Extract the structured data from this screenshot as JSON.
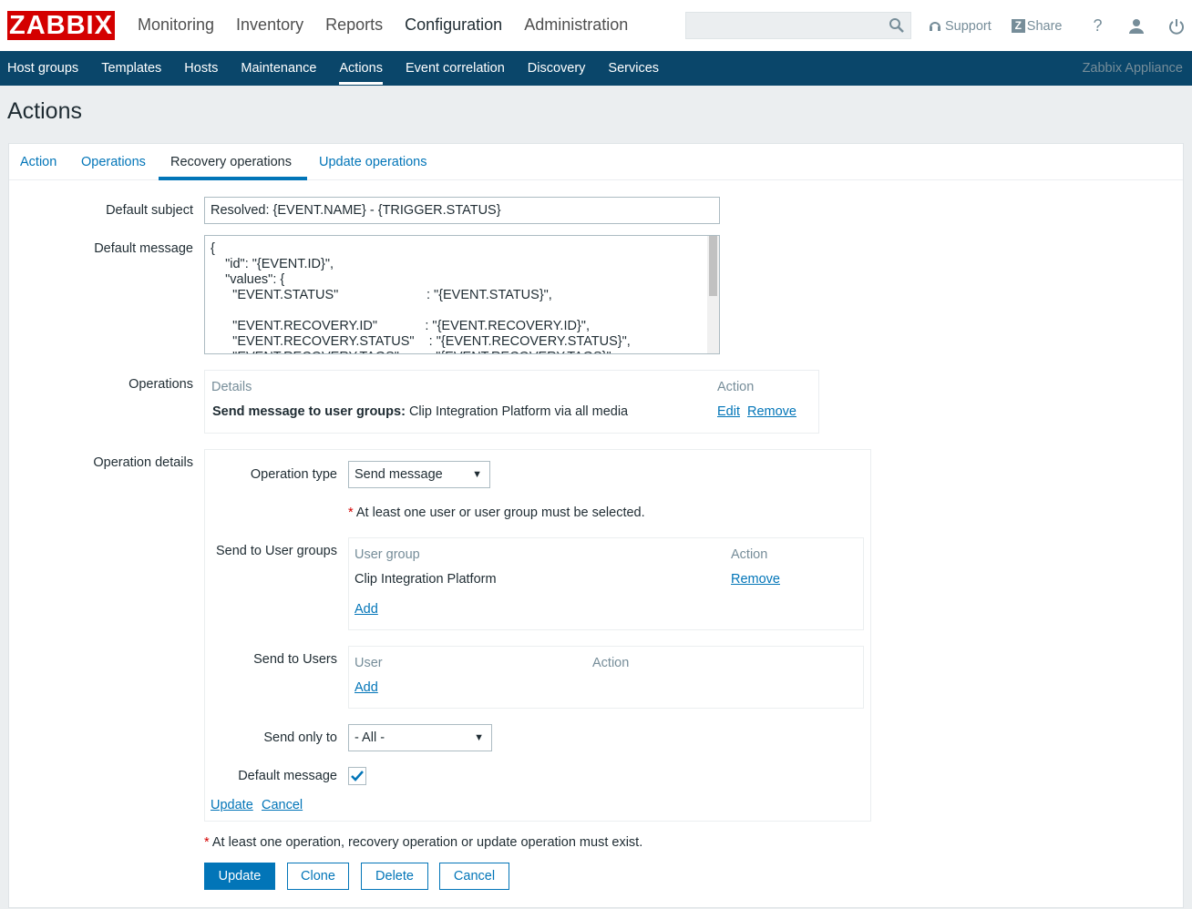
{
  "header": {
    "logo": "ZABBIX",
    "main_nav": [
      "Monitoring",
      "Inventory",
      "Reports",
      "Configuration",
      "Administration"
    ],
    "active_main": "Configuration",
    "support": "Support",
    "share": "Share",
    "help": "?"
  },
  "subnav": {
    "items": [
      "Host groups",
      "Templates",
      "Hosts",
      "Maintenance",
      "Actions",
      "Event correlation",
      "Discovery",
      "Services"
    ],
    "active": "Actions",
    "appliance": "Zabbix Appliance"
  },
  "page_title": "Actions",
  "tabs": [
    "Action",
    "Operations",
    "Recovery operations",
    "Update operations"
  ],
  "form": {
    "default_subject_label": "Default subject",
    "default_subject_value": "Resolved: {EVENT.NAME} - {TRIGGER.STATUS}",
    "default_message_label": "Default message",
    "default_message_value": "{\n    \"id\": \"{EVENT.ID}\",\n    \"values\": {\n      \"EVENT.STATUS\"                        : \"{EVENT.STATUS}\",\n\n      \"EVENT.RECOVERY.ID\"             : \"{EVENT.RECOVERY.ID}\",\n      \"EVENT.RECOVERY.STATUS\"    : \"{EVENT.RECOVERY.STATUS}\",\n      \"EVENT.RECOVERY.TAGS\"        : \"{EVENT.RECOVERY.TAGS}\",",
    "operations_label": "Operations",
    "operations_table": {
      "col_details": "Details",
      "col_action": "Action",
      "row_bold": "Send message to user groups:",
      "row_text": "Clip Integration Platform via all media",
      "edit": "Edit",
      "remove": "Remove"
    },
    "operation_details_label": "Operation details",
    "operation_type_label": "Operation type",
    "operation_type_value": "Send message",
    "requirement_note": "At least one user or user group must be selected.",
    "send_to_groups_label": "Send to User groups",
    "groups_table": {
      "col_group": "User group",
      "col_action": "Action",
      "row_group": "Clip Integration Platform",
      "remove": "Remove",
      "add": "Add"
    },
    "send_to_users_label": "Send to Users",
    "users_table": {
      "col_user": "User",
      "col_action": "Action",
      "add": "Add"
    },
    "send_only_to_label": "Send only to",
    "send_only_to_value": "- All -",
    "default_message_chk_label": "Default message",
    "details_update": "Update",
    "details_cancel": "Cancel",
    "footer_note": "At least one operation, recovery operation or update operation must exist.",
    "asterisk": "*",
    "btn_update": "Update",
    "btn_clone": "Clone",
    "btn_delete": "Delete",
    "btn_cancel": "Cancel"
  }
}
